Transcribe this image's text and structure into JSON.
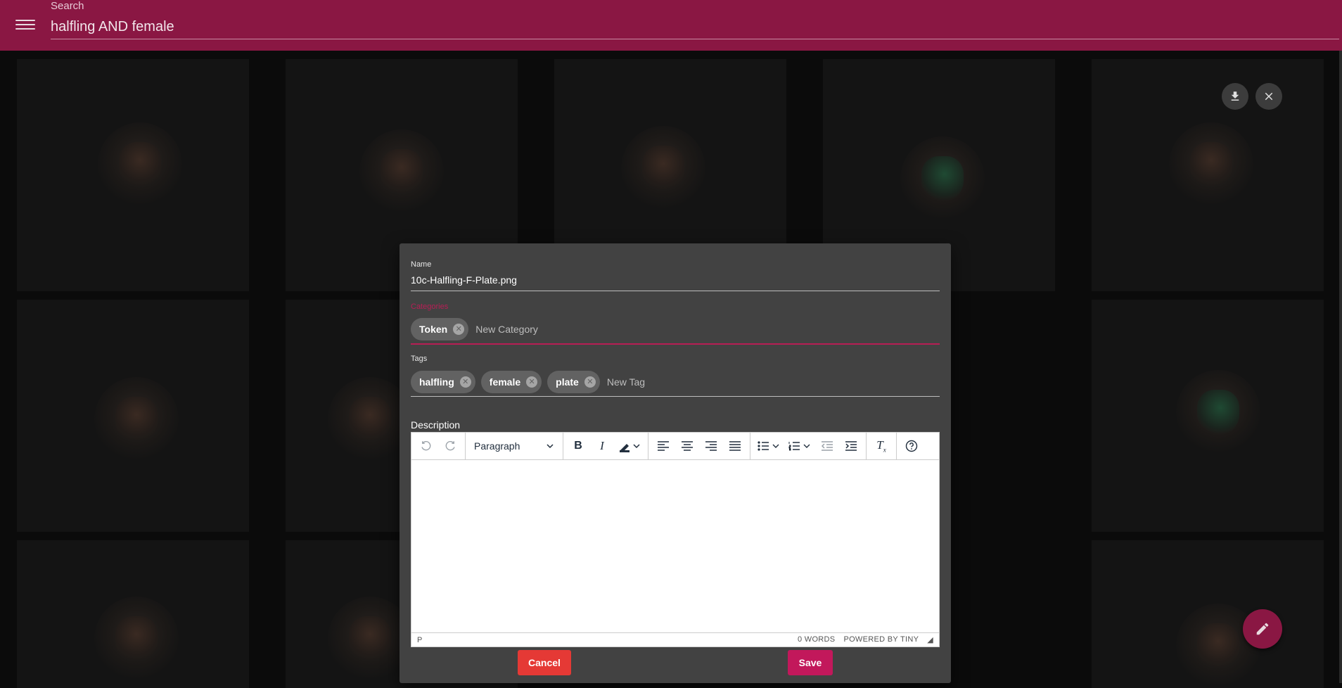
{
  "appbar": {
    "search_label": "Search",
    "search_value": "halfling AND female",
    "color": "#8a1743"
  },
  "viewer_actions": {
    "download_icon": "download-icon",
    "close_icon": "close-icon"
  },
  "dialog": {
    "name_label": "Name",
    "name_value": "10c-Halfling-F-Plate.png",
    "categories_label": "Categories",
    "categories": [
      "Token"
    ],
    "category_placeholder": "New Category",
    "tags_label": "Tags",
    "tags": [
      "halfling",
      "female",
      "plate"
    ],
    "tag_placeholder": "New Tag",
    "description_label": "Description",
    "editor": {
      "block_format": "Paragraph",
      "status_path": "P",
      "word_count": "0 WORDS",
      "powered_by": "POWERED BY TINY"
    },
    "cancel_label": "Cancel",
    "save_label": "Save"
  },
  "fab": {
    "icon": "pencil-icon"
  }
}
